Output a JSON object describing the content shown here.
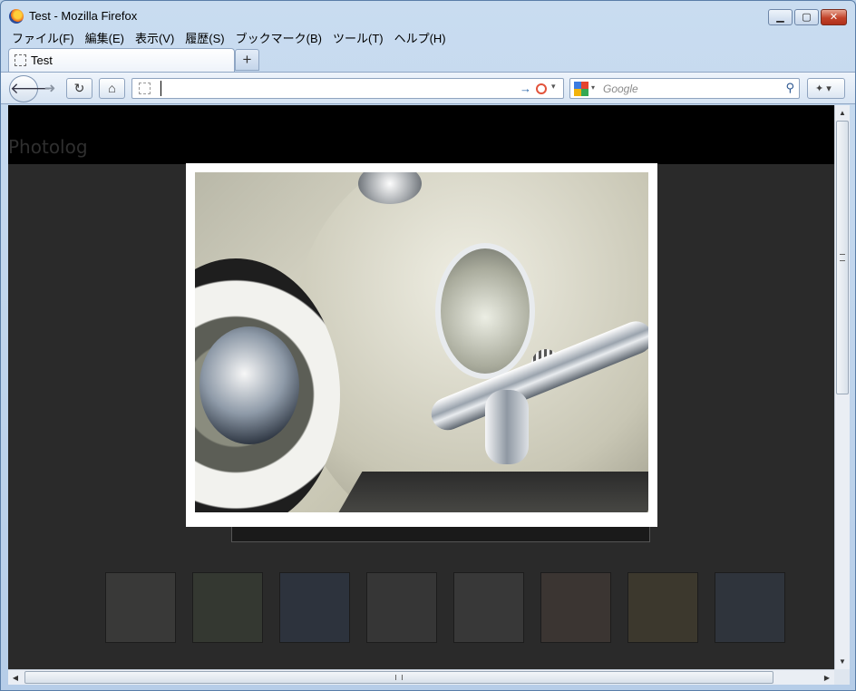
{
  "window": {
    "title": "Test - Mozilla Firefox"
  },
  "menu": {
    "items": [
      "ファイル(F)",
      "編集(E)",
      "表示(V)",
      "履歴(S)",
      "ブックマーク(B)",
      "ツール(T)",
      "ヘルプ(H)"
    ]
  },
  "tabs": [
    {
      "label": "Test"
    }
  ],
  "toolbar": {
    "newtab_label": "+",
    "back_glyph": "🡐",
    "forward_glyph": "➜",
    "reload_glyph": "↻",
    "home_glyph": "⌂",
    "url_value": "",
    "go_glyph": "→",
    "dropdown_glyph": "▾",
    "search_placeholder": "Google",
    "search_glyph": "⚲",
    "addon_glyph": "✦ ▾"
  },
  "page": {
    "site_title": "Photolog",
    "thumbnail_count": 8
  },
  "scrollbars": {
    "up": "▲",
    "down": "▼",
    "left": "◀",
    "right": "▶"
  },
  "colors": {
    "page_bg": "#2a2a2a",
    "header_bg": "#000000",
    "lightbox_frame": "#ffffff"
  }
}
